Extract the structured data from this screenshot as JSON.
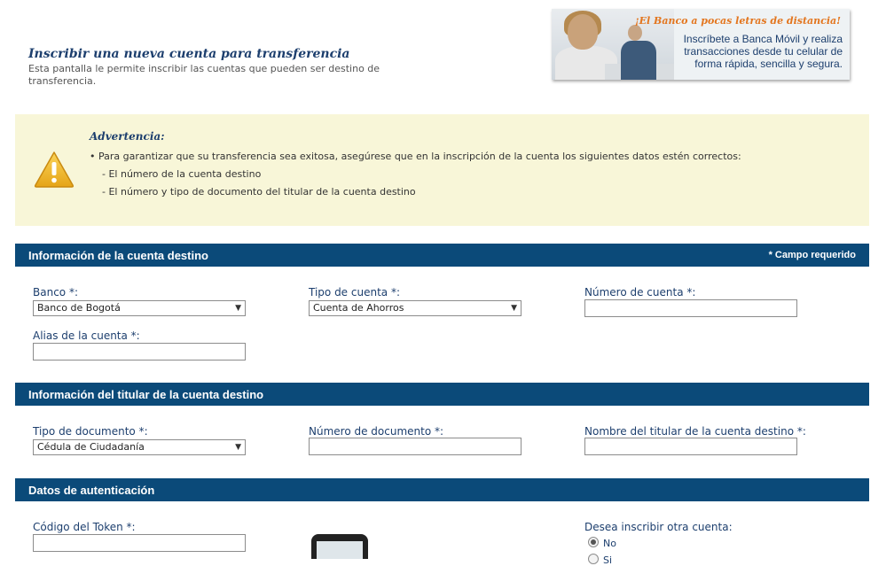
{
  "header": {
    "title": "Inscribir una nueva cuenta para transferencia",
    "description": "Esta pantalla le permite inscribir las cuentas que pueden ser destino de transferencia."
  },
  "promo": {
    "headline": "¡El Banco a pocas letras de distancia!",
    "line1": "Inscríbete a Banca Móvil y realiza",
    "line2": "transacciones desde tu celular de",
    "line3": "forma rápida, sencilla y segura."
  },
  "warning": {
    "icon": "warning-triangle-icon",
    "title": "Advertencia:",
    "bullet": "Para garantizar que su transferencia sea exitosa, asegúrese que en la inscripción de la cuenta los siguientes datos estén correctos:",
    "item1": "- El número de la cuenta destino",
    "item2": "- El número y tipo de documento del titular de la cuenta destino"
  },
  "account_section": {
    "title": "Información de la cuenta destino",
    "required_note": "* Campo requerido",
    "bank_label": "Banco *:",
    "bank_value": "Banco de Bogotá",
    "account_type_label": "Tipo de cuenta *:",
    "account_type_value": "Cuenta de Ahorros",
    "account_number_label": "Número de cuenta *:",
    "account_number_value": "",
    "alias_label": "Alias de la cuenta *:",
    "alias_value": ""
  },
  "holder_section": {
    "title": "Información del titular de la cuenta destino",
    "doc_type_label": "Tipo de documento *:",
    "doc_type_value": "Cédula de Ciudadanía",
    "doc_number_label": "Número de documento *:",
    "doc_number_value": "",
    "holder_name_label": "Nombre del titular de la cuenta destino *:",
    "holder_name_value": ""
  },
  "auth_section": {
    "title": "Datos de autenticación",
    "token_label": "Código del Token *:",
    "token_value": "",
    "another_label": "Desea inscribir otra cuenta:",
    "option_no": "No",
    "option_yes": "Si",
    "selected_option": "No"
  },
  "colors": {
    "section_bar": "#0b4a79",
    "warning_bg": "#f8f6d8",
    "title_blue": "#1d3f6e",
    "promo_orange": "#e3761f"
  }
}
